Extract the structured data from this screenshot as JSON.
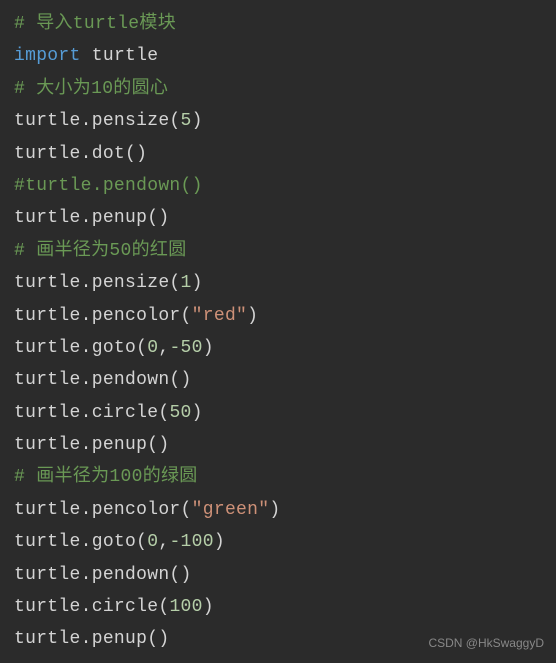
{
  "lines": {
    "l1_comment": "# 导入turtle模块",
    "l2_keyword": "import",
    "l2_space": " ",
    "l2_module": "turtle",
    "l3_comment": "# 大小为10的圆心",
    "l4_a": "turtle.pensize(",
    "l4_num": "5",
    "l4_b": ")",
    "l5": "turtle.dot()",
    "l6_comment": "#turtle.pendown()",
    "l7": "turtle.penup()",
    "l8_comment": "# 画半径为50的红圆",
    "l9_a": "turtle.pensize(",
    "l9_num": "1",
    "l9_b": ")",
    "l10_a": "turtle.pencolor(",
    "l10_str": "\"red\"",
    "l10_b": ")",
    "l11_a": "turtle.goto(",
    "l11_num1": "0",
    "l11_comma": ",",
    "l11_num2": "-50",
    "l11_b": ")",
    "l12": "turtle.pendown()",
    "l13_a": "turtle.circle(",
    "l13_num": "50",
    "l13_b": ")",
    "l14": "turtle.penup()",
    "l15_comment": "# 画半径为100的绿圆",
    "l16_a": "turtle.pencolor(",
    "l16_str": "\"green\"",
    "l16_b": ")",
    "l17_a": "turtle.goto(",
    "l17_num1": "0",
    "l17_comma": ",",
    "l17_num2": "-100",
    "l17_b": ")",
    "l18": "turtle.pendown()",
    "l19_a": "turtle.circle(",
    "l19_num": "100",
    "l19_b": ")",
    "l20": "turtle.penup()"
  },
  "watermark": "CSDN @HkSwaggyD"
}
